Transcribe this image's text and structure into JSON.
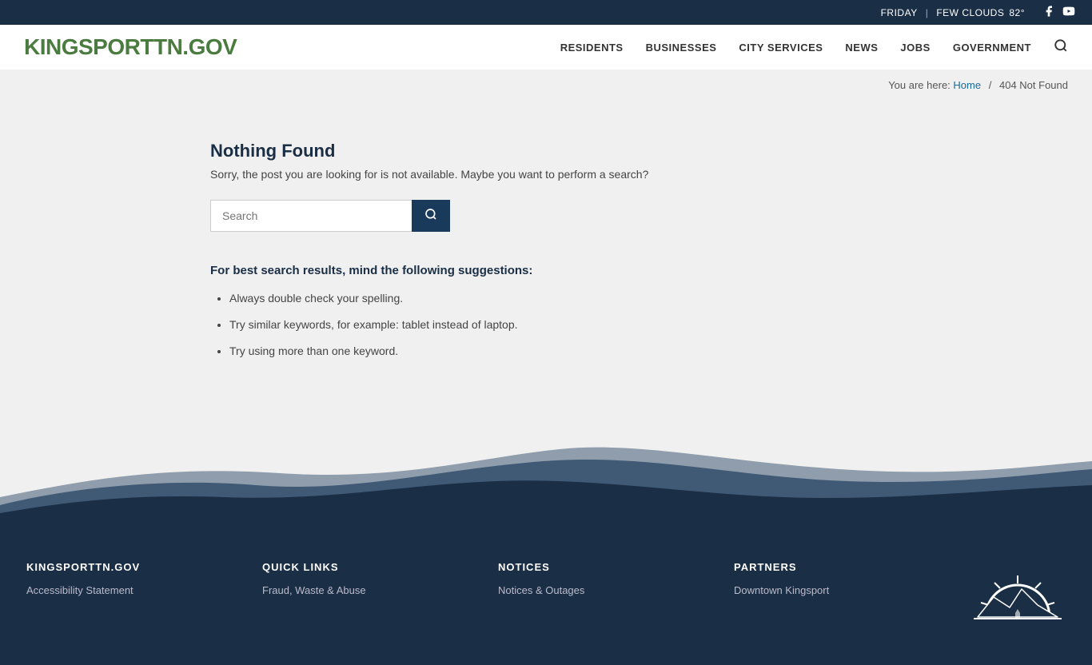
{
  "topbar": {
    "day": "FRIDAY",
    "separator": "|",
    "weather": "FEW CLOUDS",
    "temperature": "82°"
  },
  "header": {
    "logo_text1": "KINGSPORT",
    "logo_text2": "TN",
    "logo_text3": ".GOV",
    "nav_items": [
      {
        "label": "RESIDENTS",
        "key": "residents"
      },
      {
        "label": "BUSINESSES",
        "key": "businesses"
      },
      {
        "label": "CITY SERVICES",
        "key": "city-services"
      },
      {
        "label": "NEWS",
        "key": "news"
      },
      {
        "label": "JOBS",
        "key": "jobs"
      },
      {
        "label": "GOVERNMENT",
        "key": "government"
      }
    ]
  },
  "breadcrumb": {
    "you_are_here": "You are here:",
    "home": "Home",
    "current": "404 Not Found"
  },
  "main": {
    "title": "Nothing Found",
    "description": "Sorry, the post you are looking for is not available. Maybe you want to perform a search?",
    "search_placeholder": "Search",
    "suggestions_title": "For best search results, mind the following suggestions:",
    "suggestions": [
      "Always double check your spelling.",
      "Try similar keywords, for example: tablet instead of laptop.",
      "Try using more than one keyword."
    ]
  },
  "footer": {
    "col1": {
      "title": "KINGSPORTTN.GOV",
      "links": [
        "Accessibility Statement"
      ]
    },
    "col2": {
      "title": "QUICK LINKS",
      "links": [
        "Fraud, Waste & Abuse"
      ]
    },
    "col3": {
      "title": "NOTICES",
      "links": [
        "Notices & Outages"
      ]
    },
    "col4": {
      "title": "PARTNERS",
      "links": [
        "Downtown Kingsport"
      ]
    }
  },
  "colors": {
    "darkBlue": "#1a2e45",
    "green": "#4a7c3f",
    "lightBg": "#f0f0f0",
    "searchBtn": "#1a3a5c"
  }
}
